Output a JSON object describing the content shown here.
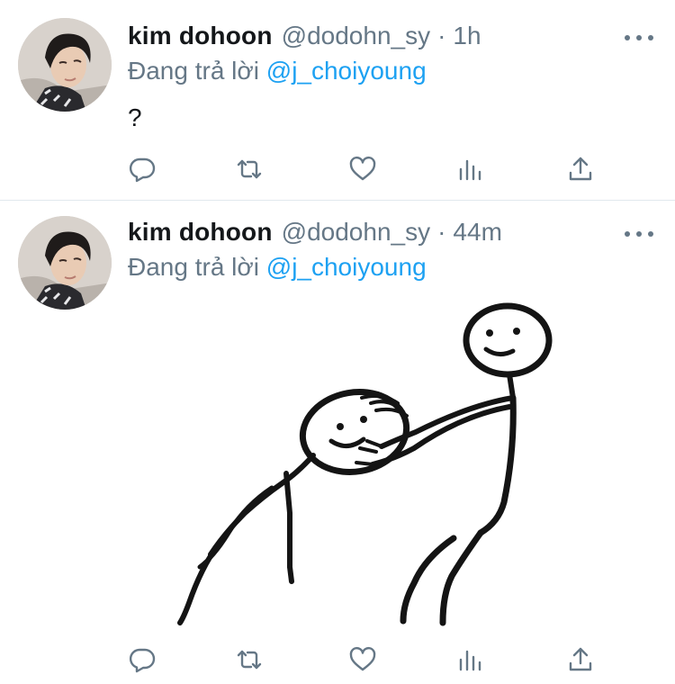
{
  "tweets": [
    {
      "author": {
        "display_name": "kim dohoon",
        "handle": "@dodohn_sy",
        "avatar_icon": "profile-photo"
      },
      "separator": "·",
      "time": "1h",
      "reply_prefix": "Đang trả lời",
      "reply_to": "@j_choiyoung",
      "text": "?",
      "media": null
    },
    {
      "author": {
        "display_name": "kim dohoon",
        "handle": "@dodohn_sy",
        "avatar_icon": "profile-photo"
      },
      "separator": "·",
      "time": "44m",
      "reply_prefix": "Đang trả lời",
      "reply_to": "@j_choiyoung",
      "text": "",
      "media": {
        "type": "image",
        "icon": "stick-figure-drawing"
      }
    }
  ],
  "actions": {
    "icons": [
      "reply-icon",
      "retweet-icon",
      "like-icon",
      "analytics-icon",
      "share-icon"
    ]
  },
  "colors": {
    "text_primary": "#14171a",
    "text_secondary": "#657786",
    "link": "#1da1f2",
    "divider": "#e1e8ed",
    "background": "#ffffff"
  }
}
